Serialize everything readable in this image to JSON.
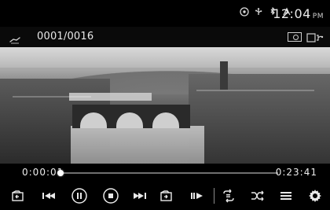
{
  "status": {
    "time": "12:04",
    "ampm": "PM",
    "icons": [
      "media-icon",
      "usb-icon",
      "bluetooth-icon",
      "signal-icon"
    ]
  },
  "info": {
    "track_counter": "0001/0016",
    "left_icon": "ok-icon",
    "right_icons": [
      "screen-toggle-icon",
      "display-audio-icon"
    ]
  },
  "playback": {
    "elapsed": "0:00:01",
    "total": "0:23:41",
    "progress": 0.01
  },
  "controls": {
    "icons": [
      "folder-back-icon",
      "previous-icon",
      "pause-icon",
      "stop-icon",
      "next-icon",
      "folder-forward-icon",
      "slow-forward-icon",
      "repeat-icon",
      "shuffle-icon",
      "list-icon",
      "settings-icon"
    ]
  }
}
